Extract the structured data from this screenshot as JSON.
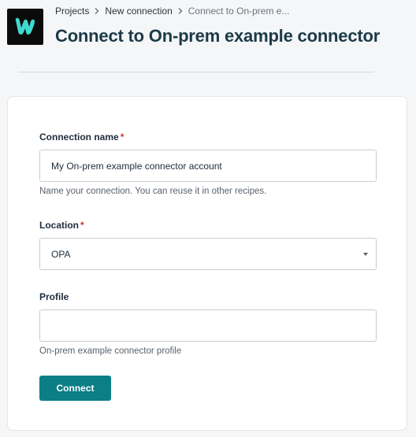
{
  "app": {
    "brand_color": "#0b0b0b",
    "logo_color": "#41d8cf",
    "accent": "#0b7e86"
  },
  "breadcrumb": {
    "items": [
      {
        "label": "Projects"
      },
      {
        "label": "New connection"
      },
      {
        "label": "Connect to On-prem e..."
      }
    ]
  },
  "page": {
    "title": "Connect to On-prem example connector"
  },
  "form": {
    "connection_name": {
      "label": "Connection name",
      "required_mark": "*",
      "value": "My On-prem example connector account",
      "hint": "Name your connection. You can reuse it in other recipes."
    },
    "location": {
      "label": "Location",
      "required_mark": "*",
      "selected": "OPA"
    },
    "profile": {
      "label": "Profile",
      "value": "",
      "hint": "On-prem example connector profile"
    },
    "submit_label": "Connect"
  }
}
